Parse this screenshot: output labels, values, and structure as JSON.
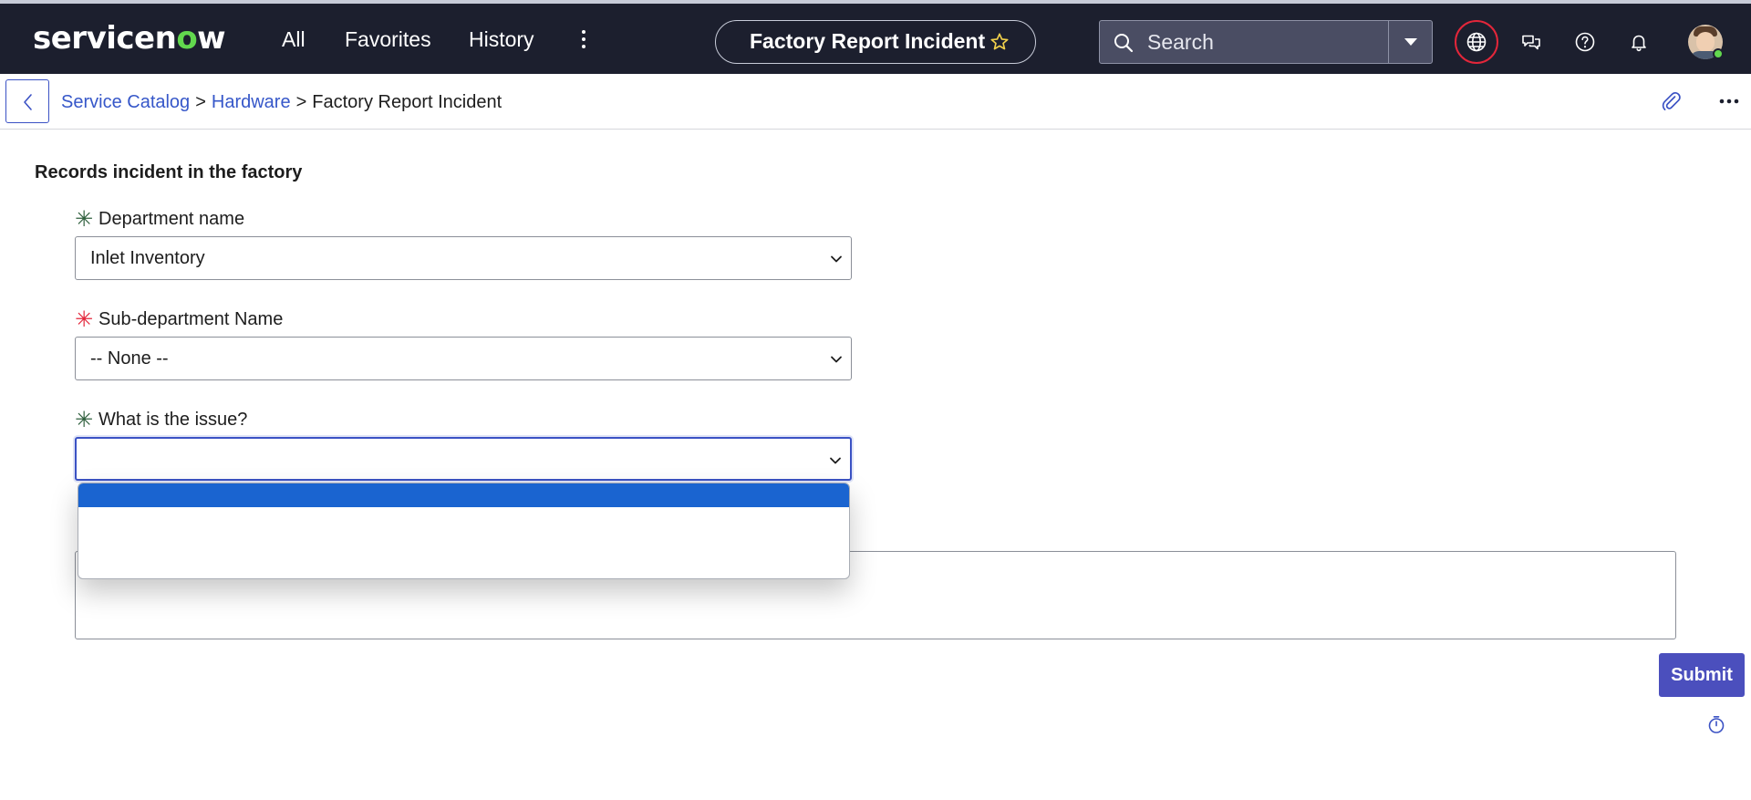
{
  "header": {
    "logo_prefix": "servicen",
    "logo_o": "o",
    "logo_suffix": "w",
    "nav": [
      "All",
      "Favorites",
      "History"
    ],
    "page_title": "Factory Report Incident",
    "search_placeholder": "Search",
    "icons": [
      "globe-icon",
      "chat-icon",
      "help-icon",
      "bell-icon"
    ]
  },
  "breadcrumb": {
    "items": [
      "Service Catalog",
      "Hardware"
    ],
    "separator": ">",
    "current": "Factory Report Incident"
  },
  "form": {
    "description": "Records incident in the factory",
    "required_marker": "✳",
    "fields": [
      {
        "label": "Department name",
        "value": "Inlet Inventory",
        "required_color": "#2e5f3c"
      },
      {
        "label": "Sub-department Name",
        "value": "-- None --",
        "required_color": "#e3263a"
      },
      {
        "label": "What is the issue?",
        "value": "",
        "required_color": "#2e5f3c"
      }
    ],
    "issue_options": [
      "",
      ""
    ],
    "submit_label": "Submit"
  },
  "colors": {
    "topbar": "#1c1f2e",
    "link": "#3657c9",
    "submit": "#4b4fbd",
    "dropdown_selected": "#1a64d0",
    "logo_accent": "#62d84e",
    "globe_ring": "#e3263a"
  }
}
